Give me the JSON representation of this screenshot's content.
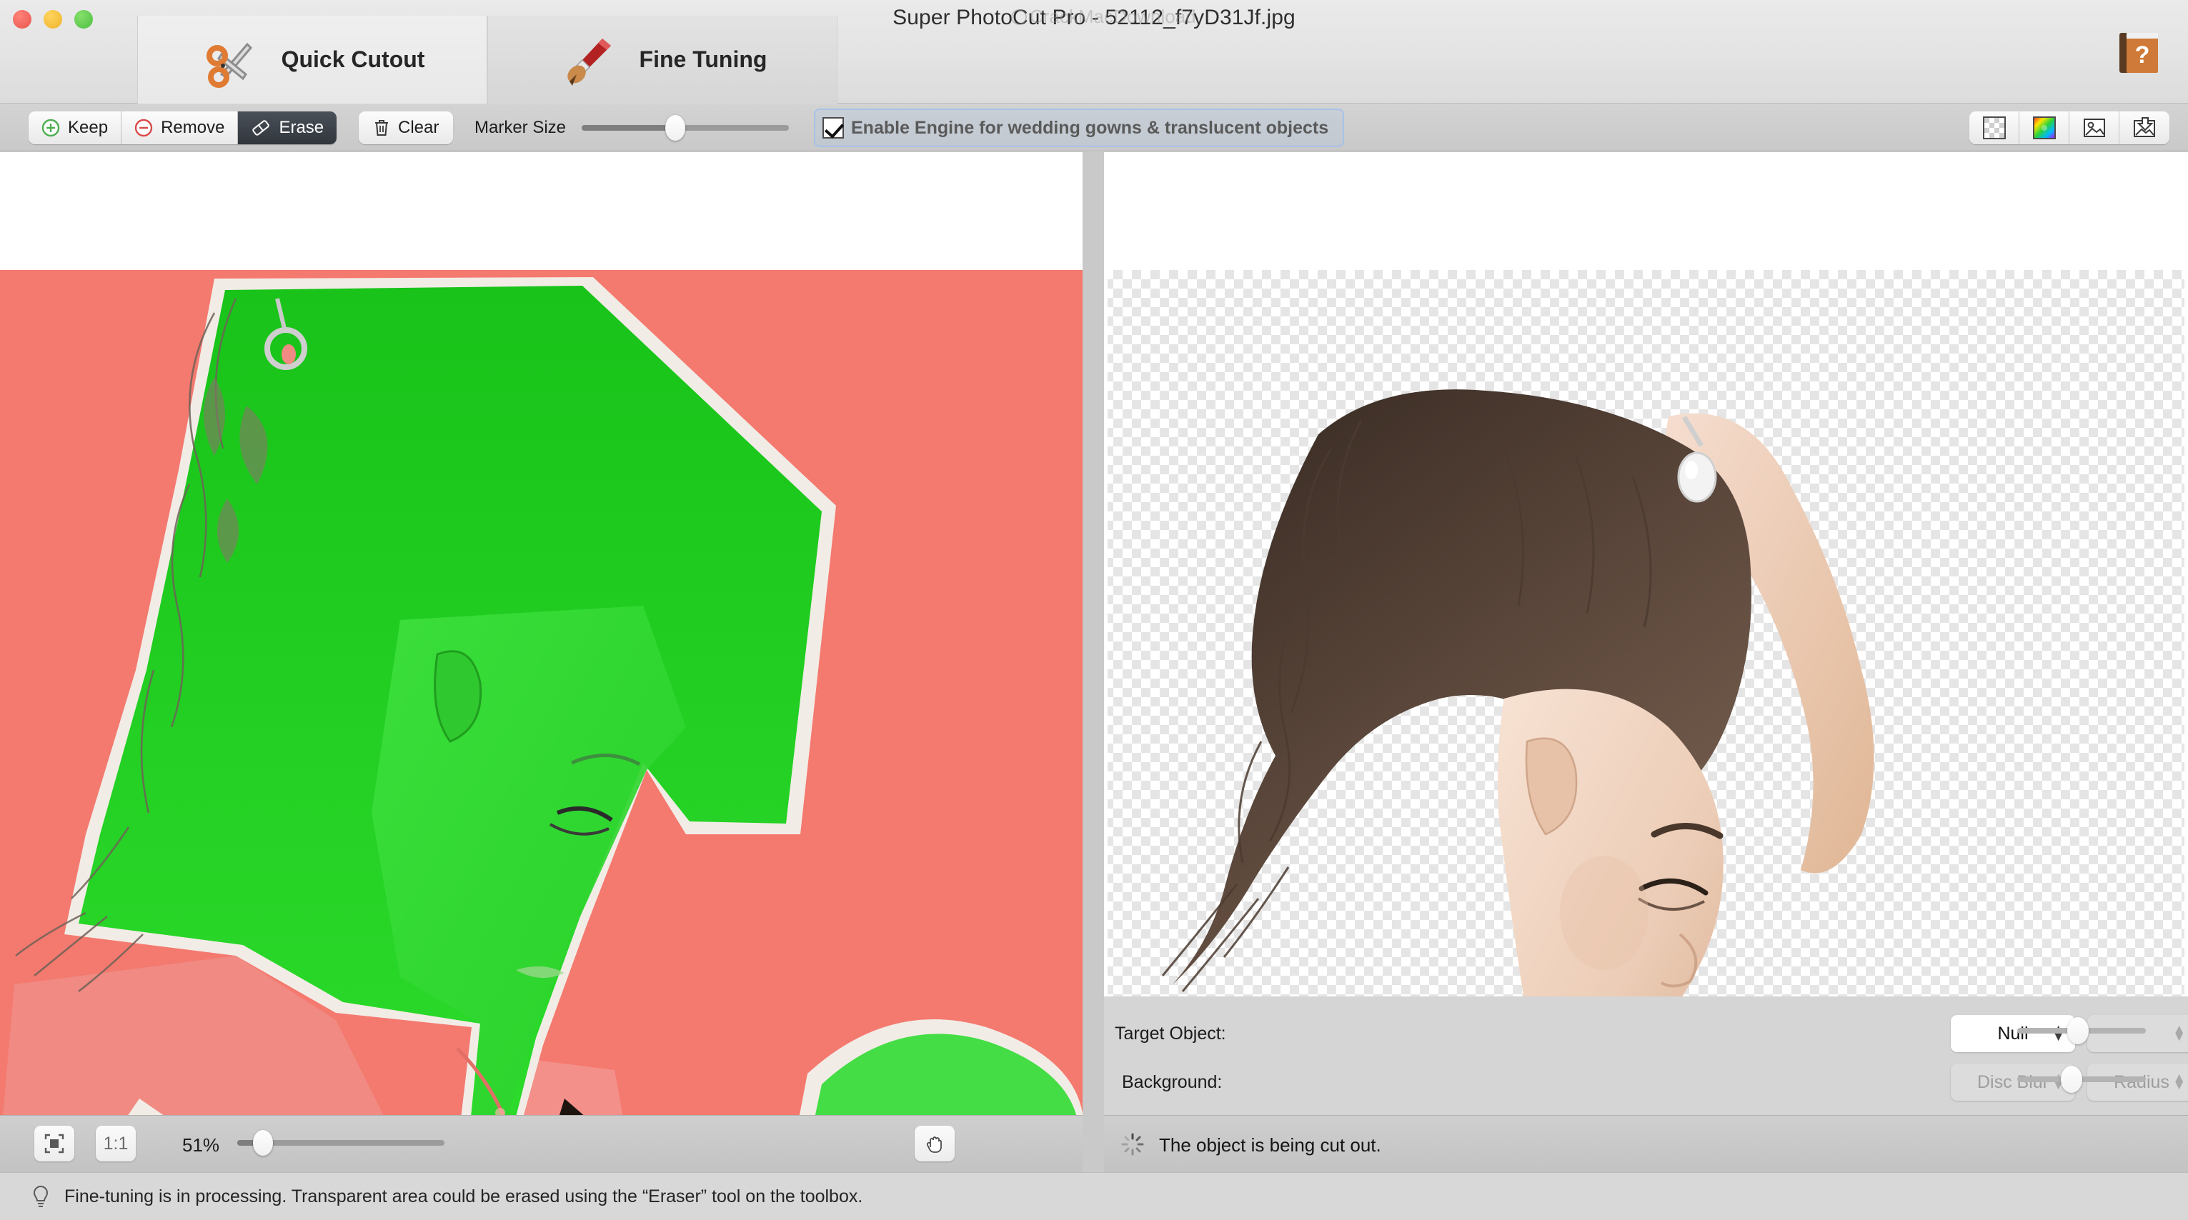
{
  "window": {
    "title": "Super PhotoCut Pro - 52112_f7yD31Jf.jpg",
    "watermark": "CrackMacDownload",
    "traffic_lights": [
      "close-button",
      "minimize-button",
      "zoom-button"
    ]
  },
  "tabs": [
    {
      "label": "Quick Cutout",
      "icon": "scissors-icon",
      "active": false
    },
    {
      "label": "Fine Tuning",
      "icon": "paintbrush-icon",
      "active": true
    }
  ],
  "help": {
    "name": "help-book-icon",
    "glyph": "?"
  },
  "toolbar": {
    "tools": [
      {
        "label": "Keep",
        "icon": "plus-circle-icon",
        "selected": false
      },
      {
        "label": "Remove",
        "icon": "minus-circle-icon",
        "selected": false
      },
      {
        "label": "Erase",
        "icon": "eraser-icon",
        "selected": true
      }
    ],
    "clear": {
      "label": "Clear",
      "icon": "trash-icon"
    },
    "marker_size": {
      "label": "Marker Size",
      "value_pct": 45
    },
    "engine": {
      "label": "Enable Engine for wedding gowns & translucent objects",
      "checked": true,
      "focus_ring_color": "#a7c2e6"
    },
    "right_icons": [
      {
        "name": "transparency-checker-icon"
      },
      {
        "name": "color-wheel-icon"
      },
      {
        "name": "background-image-icon"
      },
      {
        "name": "save-image-icon"
      }
    ]
  },
  "canvas": {
    "left": {
      "name": "source-image-canvas",
      "mask_keep_color": "#22cc22",
      "background_color": "#f4796f",
      "description": "Source photo with green keep-mask overlay"
    },
    "right": {
      "name": "result-preview-canvas",
      "checker_light": "#ffffff",
      "checker_dark": "#e5e5e5",
      "description": "Cutout result over transparency checkerboard"
    }
  },
  "controls": {
    "target_object": {
      "label": "Target Object:",
      "popup_value": "Null",
      "secondary_popup_value": "",
      "secondary_enabled": false,
      "slider_pct": 47
    },
    "background": {
      "label": "Background:",
      "popup_value": "Disc Blur",
      "popup_enabled": false,
      "secondary_popup_value": "Radius",
      "secondary_enabled": false,
      "slider_pct": 42
    }
  },
  "zoombar": {
    "fit_button": "fit-to-window-icon",
    "actual_size_button": "1:1",
    "zoom_value": "51%",
    "zoom_pct": 12,
    "hand_tool": "hand-tool-icon"
  },
  "status": {
    "icon": "spinner-icon",
    "text": "The object is being cut out."
  },
  "hint": {
    "icon": "lightbulb-icon",
    "text": "Fine-tuning is in processing. Transparent area could be erased using the “Eraser” tool on the toolbox."
  }
}
